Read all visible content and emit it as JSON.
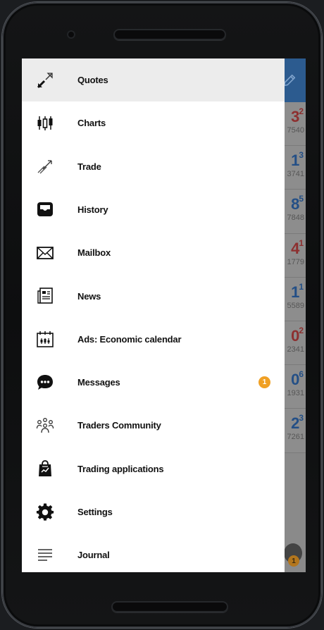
{
  "drawer": {
    "items": [
      {
        "label": "Quotes",
        "icon": "quotes-icon",
        "active": true
      },
      {
        "label": "Charts",
        "icon": "candlestick-chart-icon"
      },
      {
        "label": "Trade",
        "icon": "trade-icon"
      },
      {
        "label": "History",
        "icon": "history-inbox-icon"
      },
      {
        "label": "Mailbox",
        "icon": "mail-icon"
      },
      {
        "label": "News",
        "icon": "news-icon"
      },
      {
        "label": "Ads: Economic calendar",
        "icon": "calendar-icon"
      },
      {
        "label": "Messages",
        "icon": "chat-bubble-icon",
        "badge": "1"
      },
      {
        "label": "Traders Community",
        "icon": "community-icon"
      },
      {
        "label": "Trading applications",
        "icon": "shopping-bag-icon"
      },
      {
        "label": "Settings",
        "icon": "gear-icon"
      },
      {
        "label": "Journal",
        "icon": "journal-icon"
      }
    ]
  },
  "background_quotes": [
    {
      "big": "3",
      "sup": "2",
      "small": "7540",
      "color": "red"
    },
    {
      "big": "1",
      "sup": "3",
      "small": "3741",
      "color": "blue"
    },
    {
      "big": "8",
      "sup": "5",
      "small": "7848",
      "color": "blue"
    },
    {
      "big": "4",
      "sup": "1",
      "small": "1779",
      "color": "red"
    },
    {
      "big": "1",
      "sup": "1",
      "small": "5589",
      "color": "blue"
    },
    {
      "big": "0",
      "sup": "2",
      "small": "2341",
      "color": "red"
    },
    {
      "big": "0",
      "sup": "6",
      "small": "1931",
      "color": "blue"
    },
    {
      "big": "2",
      "sup": "3",
      "small": "7261",
      "color": "blue"
    }
  ],
  "background_chat_badge": "1",
  "colors": {
    "header_blue": "#2c5b8f",
    "badge_orange": "#f0a024",
    "active_item_bg": "#ececec",
    "quote_red": "#8d2f2f",
    "quote_blue": "#234f86"
  }
}
